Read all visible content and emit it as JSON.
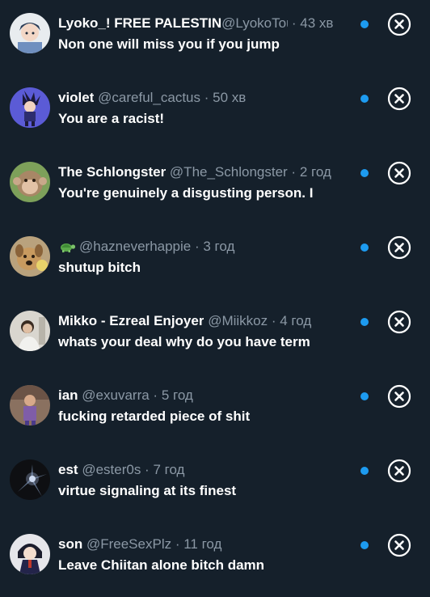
{
  "notifications": [
    {
      "name": "Lyoko_! FREE PALESTIN",
      "handle": "@LyokoTou",
      "sep": " · ",
      "time": "43 хв",
      "message": "Non one will miss you if you jump",
      "avatar_icon": "anime-character-avatar"
    },
    {
      "name": "violet",
      "handle": "@careful_cactus",
      "sep": " · ",
      "time": "50 хв",
      "message": "You are a racist!",
      "avatar_icon": "anime-character-avatar"
    },
    {
      "name": "The Schlongster",
      "handle": "@The_Schlongster",
      "sep": " · ",
      "time": "2 год",
      "message": "You're genuinely a disgusting person. I",
      "avatar_icon": "monkey-avatar"
    },
    {
      "name": "",
      "handle": "@hazneverhappie",
      "sep": " · ",
      "time": "3 год",
      "message": "shutup bitch",
      "avatar_icon": "dog-avatar",
      "name_icon": "turtle-icon"
    },
    {
      "name": "Mikko - Ezreal Enjoyer",
      "handle": "@Miikkoz",
      "sep": " · ",
      "time": "4 год",
      "message": "whats your deal why do you have term",
      "avatar_icon": "person-avatar"
    },
    {
      "name": "ian",
      "handle": "@exuvarra",
      "sep": " · ",
      "time": "5 год",
      "message": "fucking retarded piece of shit",
      "avatar_icon": "person-avatar"
    },
    {
      "name": "est",
      "handle": "@ester0s",
      "sep": " · ",
      "time": "7 год",
      "message": "virtue signaling at its finest",
      "avatar_icon": "light-burst-avatar"
    },
    {
      "name": "son",
      "handle": "@FreeSexPlz",
      "sep": " · ",
      "time": "11 год",
      "message": "Leave Chiitan alone bitch damn",
      "avatar_icon": "anime-character-avatar"
    }
  ],
  "colors": {
    "background": "#15202b",
    "text": "#ffffff",
    "secondary_text": "#8b98a5",
    "unread_dot": "#1d9bf0"
  },
  "icons": {
    "close": "close-circle-icon",
    "unread": "unread-dot"
  }
}
